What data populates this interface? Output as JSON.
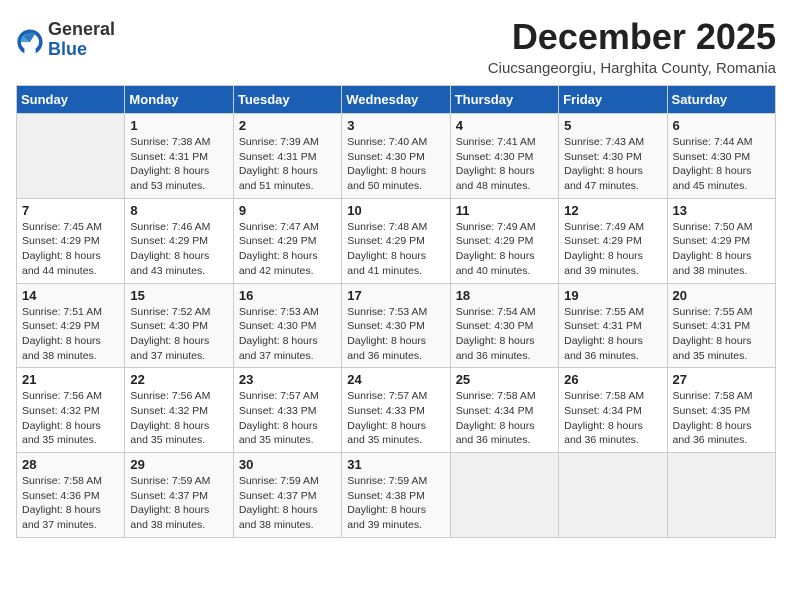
{
  "logo": {
    "general": "General",
    "blue": "Blue"
  },
  "title": "December 2025",
  "subtitle": "Ciucsangeorgiu, Harghita County, Romania",
  "days_header": [
    "Sunday",
    "Monday",
    "Tuesday",
    "Wednesday",
    "Thursday",
    "Friday",
    "Saturday"
  ],
  "weeks": [
    [
      {
        "day": "",
        "info": ""
      },
      {
        "day": "1",
        "info": "Sunrise: 7:38 AM\nSunset: 4:31 PM\nDaylight: 8 hours\nand 53 minutes."
      },
      {
        "day": "2",
        "info": "Sunrise: 7:39 AM\nSunset: 4:31 PM\nDaylight: 8 hours\nand 51 minutes."
      },
      {
        "day": "3",
        "info": "Sunrise: 7:40 AM\nSunset: 4:30 PM\nDaylight: 8 hours\nand 50 minutes."
      },
      {
        "day": "4",
        "info": "Sunrise: 7:41 AM\nSunset: 4:30 PM\nDaylight: 8 hours\nand 48 minutes."
      },
      {
        "day": "5",
        "info": "Sunrise: 7:43 AM\nSunset: 4:30 PM\nDaylight: 8 hours\nand 47 minutes."
      },
      {
        "day": "6",
        "info": "Sunrise: 7:44 AM\nSunset: 4:30 PM\nDaylight: 8 hours\nand 45 minutes."
      }
    ],
    [
      {
        "day": "7",
        "info": "Sunrise: 7:45 AM\nSunset: 4:29 PM\nDaylight: 8 hours\nand 44 minutes."
      },
      {
        "day": "8",
        "info": "Sunrise: 7:46 AM\nSunset: 4:29 PM\nDaylight: 8 hours\nand 43 minutes."
      },
      {
        "day": "9",
        "info": "Sunrise: 7:47 AM\nSunset: 4:29 PM\nDaylight: 8 hours\nand 42 minutes."
      },
      {
        "day": "10",
        "info": "Sunrise: 7:48 AM\nSunset: 4:29 PM\nDaylight: 8 hours\nand 41 minutes."
      },
      {
        "day": "11",
        "info": "Sunrise: 7:49 AM\nSunset: 4:29 PM\nDaylight: 8 hours\nand 40 minutes."
      },
      {
        "day": "12",
        "info": "Sunrise: 7:49 AM\nSunset: 4:29 PM\nDaylight: 8 hours\nand 39 minutes."
      },
      {
        "day": "13",
        "info": "Sunrise: 7:50 AM\nSunset: 4:29 PM\nDaylight: 8 hours\nand 38 minutes."
      }
    ],
    [
      {
        "day": "14",
        "info": "Sunrise: 7:51 AM\nSunset: 4:29 PM\nDaylight: 8 hours\nand 38 minutes."
      },
      {
        "day": "15",
        "info": "Sunrise: 7:52 AM\nSunset: 4:30 PM\nDaylight: 8 hours\nand 37 minutes."
      },
      {
        "day": "16",
        "info": "Sunrise: 7:53 AM\nSunset: 4:30 PM\nDaylight: 8 hours\nand 37 minutes."
      },
      {
        "day": "17",
        "info": "Sunrise: 7:53 AM\nSunset: 4:30 PM\nDaylight: 8 hours\nand 36 minutes."
      },
      {
        "day": "18",
        "info": "Sunrise: 7:54 AM\nSunset: 4:30 PM\nDaylight: 8 hours\nand 36 minutes."
      },
      {
        "day": "19",
        "info": "Sunrise: 7:55 AM\nSunset: 4:31 PM\nDaylight: 8 hours\nand 36 minutes."
      },
      {
        "day": "20",
        "info": "Sunrise: 7:55 AM\nSunset: 4:31 PM\nDaylight: 8 hours\nand 35 minutes."
      }
    ],
    [
      {
        "day": "21",
        "info": "Sunrise: 7:56 AM\nSunset: 4:32 PM\nDaylight: 8 hours\nand 35 minutes."
      },
      {
        "day": "22",
        "info": "Sunrise: 7:56 AM\nSunset: 4:32 PM\nDaylight: 8 hours\nand 35 minutes."
      },
      {
        "day": "23",
        "info": "Sunrise: 7:57 AM\nSunset: 4:33 PM\nDaylight: 8 hours\nand 35 minutes."
      },
      {
        "day": "24",
        "info": "Sunrise: 7:57 AM\nSunset: 4:33 PM\nDaylight: 8 hours\nand 35 minutes."
      },
      {
        "day": "25",
        "info": "Sunrise: 7:58 AM\nSunset: 4:34 PM\nDaylight: 8 hours\nand 36 minutes."
      },
      {
        "day": "26",
        "info": "Sunrise: 7:58 AM\nSunset: 4:34 PM\nDaylight: 8 hours\nand 36 minutes."
      },
      {
        "day": "27",
        "info": "Sunrise: 7:58 AM\nSunset: 4:35 PM\nDaylight: 8 hours\nand 36 minutes."
      }
    ],
    [
      {
        "day": "28",
        "info": "Sunrise: 7:58 AM\nSunset: 4:36 PM\nDaylight: 8 hours\nand 37 minutes."
      },
      {
        "day": "29",
        "info": "Sunrise: 7:59 AM\nSunset: 4:37 PM\nDaylight: 8 hours\nand 38 minutes."
      },
      {
        "day": "30",
        "info": "Sunrise: 7:59 AM\nSunset: 4:37 PM\nDaylight: 8 hours\nand 38 minutes."
      },
      {
        "day": "31",
        "info": "Sunrise: 7:59 AM\nSunset: 4:38 PM\nDaylight: 8 hours\nand 39 minutes."
      },
      {
        "day": "",
        "info": ""
      },
      {
        "day": "",
        "info": ""
      },
      {
        "day": "",
        "info": ""
      }
    ]
  ]
}
